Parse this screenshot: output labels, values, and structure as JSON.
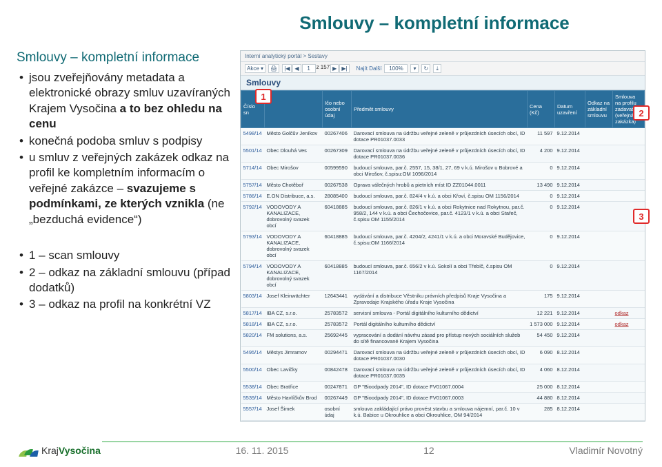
{
  "title": "Smlouvy – kompletní informace",
  "subheading": "Smlouvy – kompletní informace",
  "bullets": [
    {
      "pre": "jsou zveřejňovány metadata a elektronické obrazy smluv uzavíraných Krajem Vysočina ",
      "bold": "a to bez ohledu na cenu",
      "post": ""
    },
    {
      "pre": "konečná podoba smluv s podpisy",
      "bold": "",
      "post": ""
    },
    {
      "pre": "u smluv z veřejných zakázek odkaz na profil ke kompletním informacím o veřejné zakázce – ",
      "bold": "svazujeme s podmínkami, ze kterých vznikla",
      "post": " (ne „bezduchá evidence“)"
    }
  ],
  "legend_items": [
    "1 – scan smlouvy",
    "2 – odkaz na základní smlouvu (případ dodatků)",
    "3 – odkaz na profil na konkrétní VZ"
  ],
  "markers": {
    "m1": "1",
    "m2": "2",
    "m3": "3"
  },
  "app": {
    "breadcrumb": "Interní analytický portál > Sestavy",
    "toolbar": {
      "akce": "Akce ▾",
      "print": "🖨",
      "pager_first": "|◀",
      "pager_prev": "◀",
      "pager_cur": "1",
      "pager_of": "z 157",
      "pager_next": "▶",
      "pager_last": "▶|",
      "next_more": "Najít Další",
      "zoom": "100%",
      "zoomdown": "▾",
      "refresh": "↻",
      "export": "⤓"
    },
    "section": "Smlouvy",
    "headers": [
      "Číslo sn",
      "",
      "Ičo nebo osobní údaj",
      "Předmět smlouvy",
      "Cena (Kč)",
      "Datum uzavření",
      "Odkaz na základní smlouvu",
      "Smlouva na profilu zadavatele (veřejná zakázka)"
    ],
    "rows": [
      {
        "c0": "5498/14",
        "c1": "Město Golčův Jeníkov",
        "c2": "00267406",
        "c3": "Darovací smlouva na údržbu veřejné zeleně v průjezdních úsecích obcí, ID dotace PR01037.0033",
        "c4": "11 597",
        "c5": "9.12.2014",
        "c6": "",
        "c7": ""
      },
      {
        "c0": "5501/14",
        "c1": "Obec Dlouhá Ves",
        "c2": "00267309",
        "c3": "Darovací smlouva na údržbu veřejné zeleně v průjezdních úsecích obcí, ID dotace PR01037.0036",
        "c4": "4 200",
        "c5": "9.12.2014",
        "c6": "",
        "c7": ""
      },
      {
        "c0": "5714/14",
        "c1": "Obec Mirošov",
        "c2": "00599590",
        "c3": "budoucí smlouva, par.č. 2557, 15, 38/1, 27, 69 v k.ú. Mirošov u Bobrové a obci Mirošov, č.spisu:OM 1096/2014",
        "c4": "0",
        "c5": "9.12.2014",
        "c6": "",
        "c7": ""
      },
      {
        "c0": "5757/14",
        "c1": "Město Chotěboř",
        "c2": "00267538",
        "c3": "Oprava válečných hrobů a pietních míst ID ZZ01044.0011",
        "c4": "13 490",
        "c5": "9.12.2014",
        "c6": "",
        "c7": ""
      },
      {
        "c0": "5786/14",
        "c1": "E.ON Distribuce, a.s.",
        "c2": "28085400",
        "c3": "budoucí smlouva, par.č. 824/4 v k.ú. a obci Křoví, č.spisu OM 1156/2014",
        "c4": "0",
        "c5": "9.12.2014",
        "c6": "",
        "c7": ""
      },
      {
        "c0": "5792/14",
        "c1": "VODOVODY A KANALIZACE, dobrovolný svazek obcí",
        "c2": "60418885",
        "c3": "budoucí smlouva, par.č. 826/1 v k.ú. a obci Rokytnice nad Rokytnou, par.č. 958/2, 144 v k.ú. a obci Čechočovice, par.č. 4123/1 v k.ú. a obci Stařeč, č.spisu OM 1155/2014",
        "c4": "0",
        "c5": "9.12.2014",
        "c6": "",
        "c7": ""
      },
      {
        "c0": "5793/14",
        "c1": "VODOVODY A KANALIZACE, dobrovolný svazek obcí",
        "c2": "60418885",
        "c3": "budoucí smlouva, par.č. 4204/2, 4241/1 v k.ú. a obci Moravské Budějovice, č.spisu:OM 1166/2014",
        "c4": "0",
        "c5": "9.12.2014",
        "c6": "",
        "c7": ""
      },
      {
        "c0": "5794/14",
        "c1": "VODOVODY A KANALIZACE, dobrovolný svazek obcí",
        "c2": "60418885",
        "c3": "budoucí smlouva, par.č. 656/2 v k.ú. Sokolí a obci Třebíč, č.spisu OM 1167/2014",
        "c4": "0",
        "c5": "9.12.2014",
        "c6": "",
        "c7": ""
      },
      {
        "c0": "5803/14",
        "c1": "Josef Kleinwächter",
        "c2": "12643441",
        "c3": "vydávání a distribuce Věstníku právních předpisů Kraje Vysočina a Zpravodaje Krajského úřadu Kraje Vysočina",
        "c4": "175",
        "c5": "9.12.2014",
        "c6": "",
        "c7": ""
      },
      {
        "c0": "5817/14",
        "c1": "IBA CZ, s.r.o.",
        "c2": "25783572",
        "c3": "servisní smlouva - Portál digitálního kulturního dědictví",
        "c4": "12 221",
        "c5": "9.12.2014",
        "c6": "",
        "c7": "odkaz"
      },
      {
        "c0": "5818/14",
        "c1": "IBA CZ, s.r.o.",
        "c2": "25783572",
        "c3": "Portál digitálního kulturního dědictví",
        "c4": "1 573 000",
        "c5": "9.12.2014",
        "c6": "",
        "c7": "odkaz"
      },
      {
        "c0": "5820/14",
        "c1": "FM solutions, a.s.",
        "c2": "25692445",
        "c3": "vypracování a dodání návrhu zásad pro přístup nových sociálních služeb do sítě financované Krajem Vysočina",
        "c4": "54 450",
        "c5": "9.12.2014",
        "c6": "",
        "c7": ""
      },
      {
        "c0": "5495/14",
        "c1": "Městys Jimramov",
        "c2": "00294471",
        "c3": "Darovací smlouva na údržbu veřejné zeleně v průjezdních úsecích obcí, ID dotace PR01037.0030",
        "c4": "6 090",
        "c5": "8.12.2014",
        "c6": "",
        "c7": ""
      },
      {
        "c0": "5500/14",
        "c1": "Obec Lavičky",
        "c2": "00842478",
        "c3": "Darovací smlouva na údržbu veřejné zeleně v průjezdních úsecích obcí, ID dotace PR01037.0035",
        "c4": "4 060",
        "c5": "8.12.2014",
        "c6": "",
        "c7": ""
      },
      {
        "c0": "5538/14",
        "c1": "Obec Bratřice",
        "c2": "00247871",
        "c3": "GP \"Bioodpady 2014\", ID dotace FV01067.0004",
        "c4": "25 000",
        "c5": "8.12.2014",
        "c6": "",
        "c7": ""
      },
      {
        "c0": "5539/14",
        "c1": "Město Havlíčkův Brod",
        "c2": "00267449",
        "c3": "GP \"Bioodpady 2014\", ID dotace FV01067.0003",
        "c4": "44 880",
        "c5": "8.12.2014",
        "c6": "",
        "c7": ""
      },
      {
        "c0": "5557/14",
        "c1": "Josef Šimek",
        "c2": "osobní údaj",
        "c3": "smlouva zakládající právo provést stavbu a smlouva nájemní, par.č. 10 v k.ú. Babice u Okrouhlice a obci Okrouhlice, OM 94/2014",
        "c4": "285",
        "c5": "8.12.2014",
        "c6": "",
        "c7": ""
      }
    ]
  },
  "footer": {
    "date": "16. 11. 2015",
    "page": "12",
    "author": "Vladimír Novotný",
    "logo_text_a": "Kraj",
    "logo_text_b": "Vysočina"
  }
}
